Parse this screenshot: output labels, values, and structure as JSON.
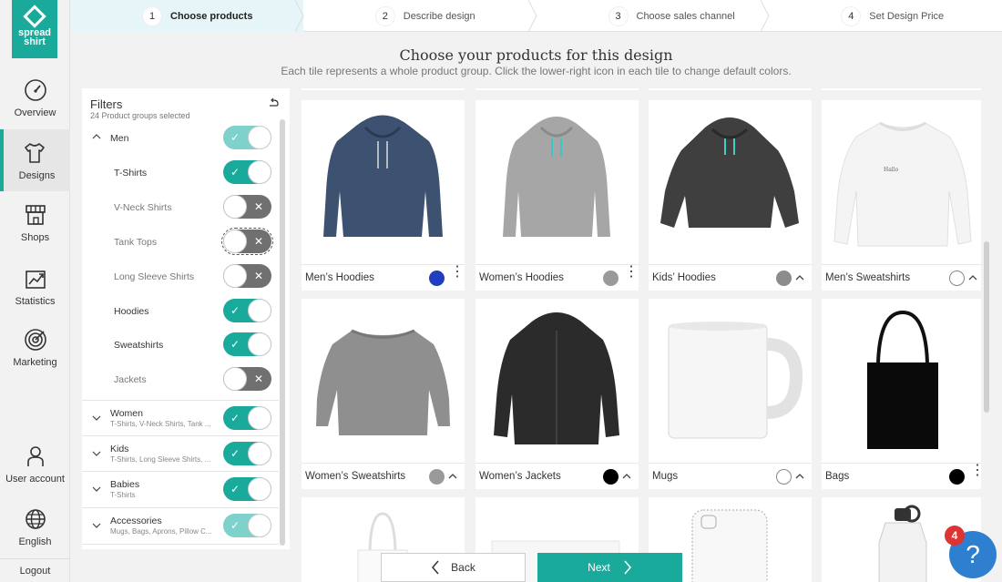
{
  "brand": {
    "line1": "spread",
    "line2": "shirt",
    "accent": "#1aaa9c"
  },
  "nav": {
    "items": [
      {
        "label": "Overview",
        "icon": "speedometer-icon"
      },
      {
        "label": "Designs",
        "icon": "tshirt-icon"
      },
      {
        "label": "Shops",
        "icon": "storefront-icon"
      },
      {
        "label": "Statistics",
        "icon": "chart-icon"
      },
      {
        "label": "Marketing",
        "icon": "target-icon"
      },
      {
        "label": "User account",
        "icon": "user-icon"
      },
      {
        "label": "English",
        "icon": "globe-icon"
      }
    ],
    "logout": "Logout"
  },
  "steps": [
    {
      "num": "1",
      "label": "Choose products"
    },
    {
      "num": "2",
      "label": "Describe design"
    },
    {
      "num": "3",
      "label": "Choose sales channel"
    },
    {
      "num": "4",
      "label": "Set Design Price"
    }
  ],
  "header": {
    "title": "Choose your products for this design",
    "subtitle": "Each tile represents a whole product group. Click the lower-right icon in each tile to change default colors."
  },
  "filters": {
    "title": "Filters",
    "count": "24 Product groups selected",
    "groups": [
      {
        "label": "Men",
        "sub": ""
      },
      {
        "label": "Women",
        "sub": "T-Shirts, V-Neck Shirts, Tank ..."
      },
      {
        "label": "Kids",
        "sub": "T-Shirts, Long Sleeve Shirts, ..."
      },
      {
        "label": "Babies",
        "sub": "T-Shirts"
      },
      {
        "label": "Accessories",
        "sub": "Mugs, Bags, Aprons, Pillow C..."
      }
    ],
    "men_items": [
      {
        "label": "T-Shirts"
      },
      {
        "label": "V-Neck Shirts"
      },
      {
        "label": "Tank Tops"
      },
      {
        "label": "Long Sleeve Shirts"
      },
      {
        "label": "Hoodies"
      },
      {
        "label": "Sweatshirts"
      },
      {
        "label": "Jackets"
      }
    ]
  },
  "tiles": [
    {
      "name": "Men’s Hoodies",
      "swatch": "#1f3fbf",
      "action": "more-icon"
    },
    {
      "name": "Women’s Hoodies",
      "swatch": "#9a9a9a",
      "action": "more-icon"
    },
    {
      "name": "Kids’ Hoodies",
      "swatch": "#8c8c8c",
      "action": "chevron-up-icon"
    },
    {
      "name": "Men’s Sweatshirts",
      "swatch": "#ffffff",
      "action": "chevron-up-icon"
    },
    {
      "name": "Women’s Sweatshirts",
      "swatch": "#9a9a9a",
      "action": "chevron-up-icon"
    },
    {
      "name": "Women’s Jackets",
      "swatch": "#000000",
      "action": "chevron-up-icon"
    },
    {
      "name": "Mugs",
      "swatch": "#ffffff",
      "action": "chevron-up-icon"
    },
    {
      "name": "Bags",
      "swatch": "#000000",
      "action": "more-icon"
    }
  ],
  "buttons": {
    "back": "Back",
    "next": "Next"
  },
  "help": {
    "badge": "4",
    "label": "?"
  }
}
